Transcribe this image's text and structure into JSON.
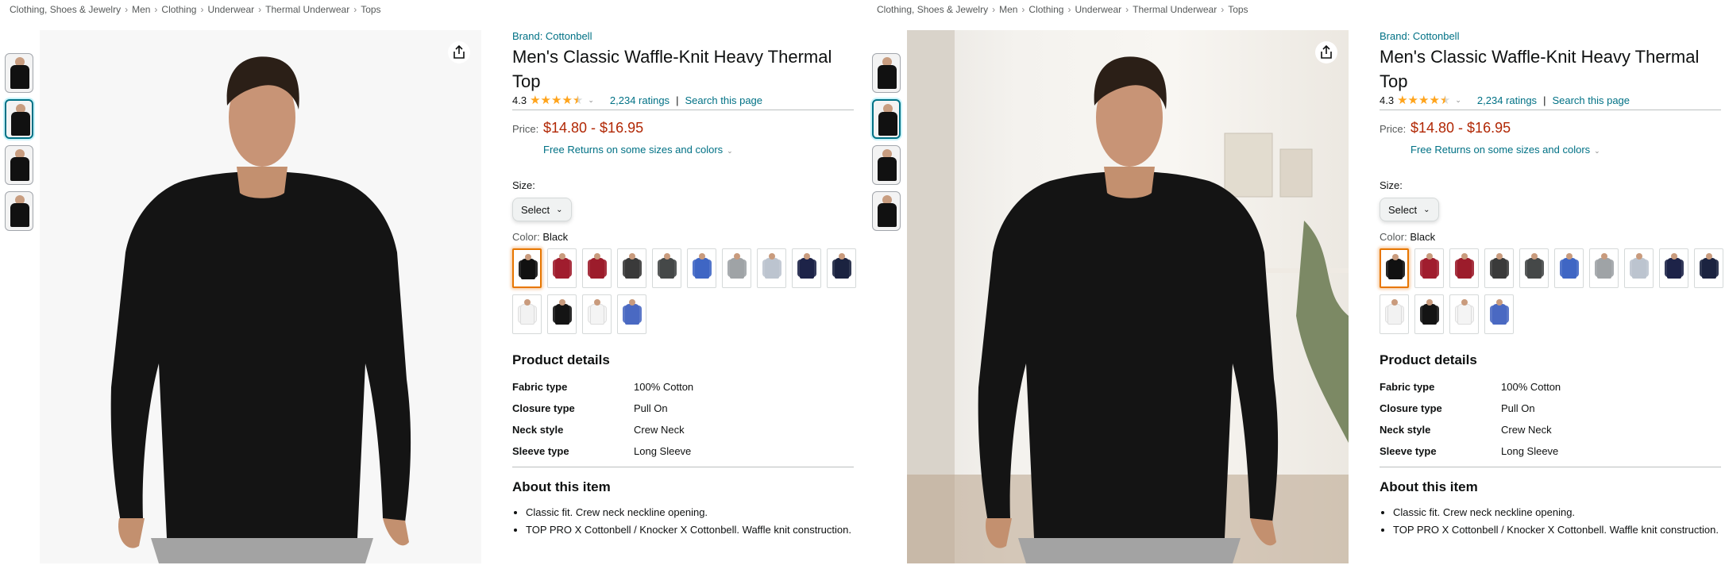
{
  "breadcrumb": [
    "Clothing, Shoes & Jewelry",
    "Men",
    "Clothing",
    "Underwear",
    "Thermal Underwear",
    "Tops"
  ],
  "product": {
    "brand": "Brand: Cottonbell",
    "title": "Men's Classic Waffle-Knit Heavy Thermal Top",
    "rating_value": "4.3",
    "rating_stars": 4.5,
    "ratings_count": "2,234 ratings",
    "search_link": "Search this page",
    "price_label": "Price:",
    "price_range": "$14.80 - $16.95",
    "returns_text": "Free Returns on some sizes and colors",
    "size_label": "Size:",
    "size_select": "Select",
    "color_label": "Color:",
    "color_value": "Black",
    "swatch_colors": [
      "#111111",
      "#a01d2e",
      "#9c1c2b",
      "#3a3a3a",
      "#454848",
      "#3f66c4",
      "#9fa3a6",
      "#bcc4cf",
      "#1d2348",
      "#1b2340",
      "#f2f2f2",
      "#141414",
      "#f4f4f4",
      "#4a69c2"
    ],
    "selected_swatch": 0,
    "details_title": "Product details",
    "details": [
      {
        "key": "Fabric type",
        "value": "100% Cotton"
      },
      {
        "key": "Closure type",
        "value": "Pull On"
      },
      {
        "key": "Neck style",
        "value": "Crew Neck"
      },
      {
        "key": "Sleeve type",
        "value": "Long Sleeve"
      }
    ],
    "about_title": "About this item",
    "bullets": [
      "Classic fit. Crew neck neckline opening.",
      "TOP PRO X Cottonbell / Knocker X Cottonbell. Waffle knit construction."
    ]
  },
  "panels": [
    {
      "active_thumb": 1,
      "background": "studio"
    },
    {
      "active_thumb": 1,
      "background": "room"
    }
  ],
  "icons": {
    "share": "share-icon",
    "star": "star-icon",
    "chevron": "chevron-down-icon"
  },
  "colors": {
    "link": "#007185",
    "price": "#b12704",
    "star": "#ffa41c",
    "selected_border": "#e77600"
  }
}
